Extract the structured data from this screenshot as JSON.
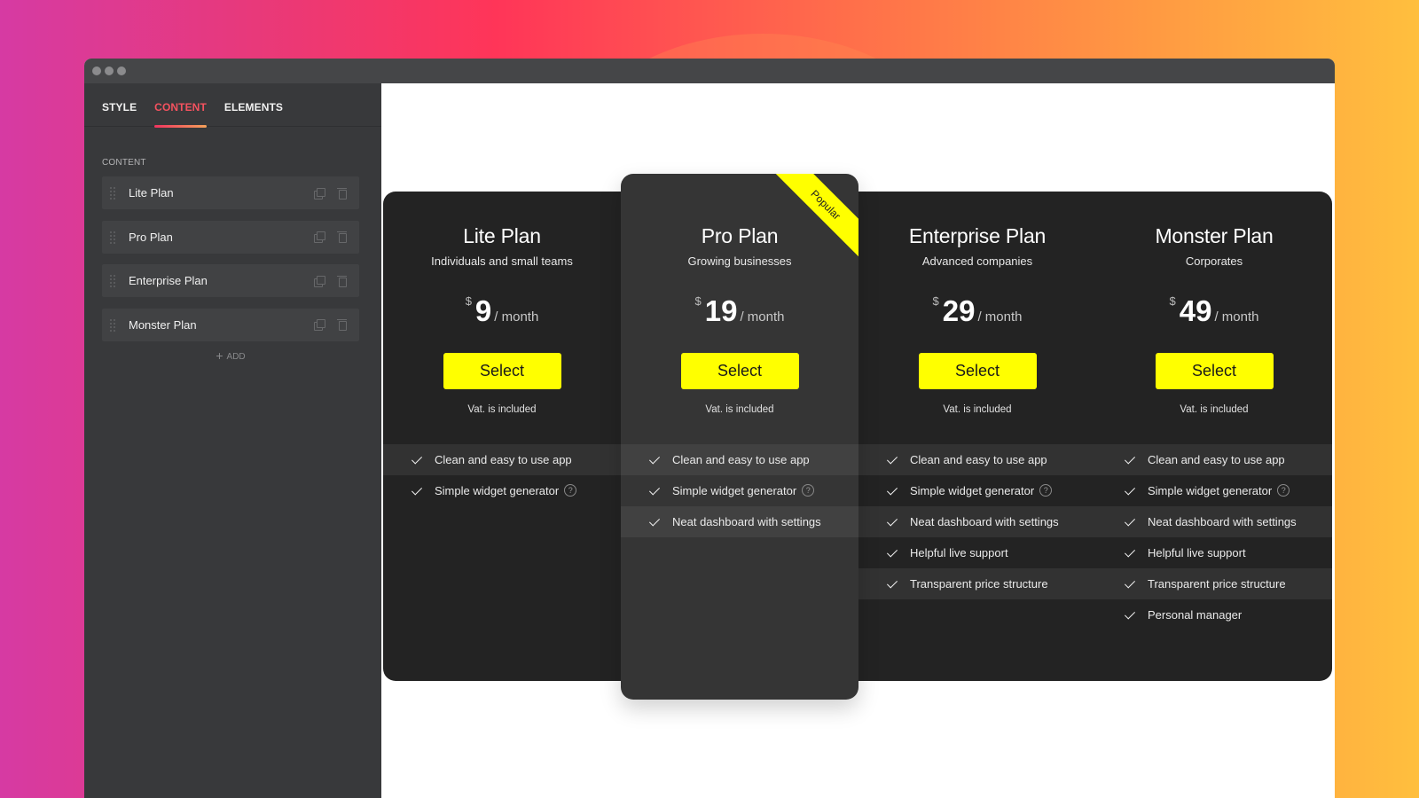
{
  "window": {
    "controls": [
      "close",
      "minimize",
      "maximize"
    ]
  },
  "sidebar": {
    "tabs": [
      {
        "label": "STYLE",
        "active": false
      },
      {
        "label": "CONTENT",
        "active": true
      },
      {
        "label": "ELEMENTS",
        "active": false
      }
    ],
    "section_label": "CONTENT",
    "items": [
      {
        "label": "Lite Plan"
      },
      {
        "label": "Pro Plan"
      },
      {
        "label": "Enterprise Plan"
      },
      {
        "label": "Monster Plan"
      }
    ],
    "add_label": "ADD",
    "add_icon": "+"
  },
  "colors": {
    "accent": "#f5525f",
    "button": "#ffff00",
    "card_dark": "#232323",
    "card_featured": "#353535"
  },
  "plans": [
    {
      "name": "Lite Plan",
      "subtitle": "Individuals and small teams",
      "currency": "$",
      "amount": "9",
      "period": "/ month",
      "button": "Select",
      "vat": "Vat. is included",
      "features": [
        {
          "text": "Clean and easy to use app",
          "help": false
        },
        {
          "text": "Simple widget generator",
          "help": true
        }
      ]
    },
    {
      "name": "Pro Plan",
      "subtitle": "Growing businesses",
      "currency": "$",
      "amount": "19",
      "period": "/ month",
      "button": "Select",
      "vat": "Vat. is included",
      "badge": "Popular",
      "features": [
        {
          "text": "Clean and easy to use app",
          "help": false
        },
        {
          "text": "Simple widget generator",
          "help": true
        },
        {
          "text": "Neat dashboard with settings",
          "help": false
        }
      ]
    },
    {
      "name": "Enterprise Plan",
      "subtitle": "Advanced companies",
      "currency": "$",
      "amount": "29",
      "period": "/ month",
      "button": "Select",
      "vat": "Vat. is included",
      "features": [
        {
          "text": "Clean and easy to use app",
          "help": false
        },
        {
          "text": "Simple widget generator",
          "help": true
        },
        {
          "text": "Neat dashboard with settings",
          "help": false
        },
        {
          "text": "Helpful live support",
          "help": false
        },
        {
          "text": "Transparent price structure",
          "help": false
        }
      ]
    },
    {
      "name": "Monster Plan",
      "subtitle": "Corporates",
      "currency": "$",
      "amount": "49",
      "period": "/ month",
      "button": "Select",
      "vat": "Vat. is included",
      "features": [
        {
          "text": "Clean and easy to use app",
          "help": false
        },
        {
          "text": "Simple widget generator",
          "help": true
        },
        {
          "text": "Neat dashboard with settings",
          "help": false
        },
        {
          "text": "Helpful live support",
          "help": false
        },
        {
          "text": "Transparent price structure",
          "help": false
        },
        {
          "text": "Personal manager",
          "help": false
        }
      ]
    }
  ],
  "help_glyph": "?"
}
